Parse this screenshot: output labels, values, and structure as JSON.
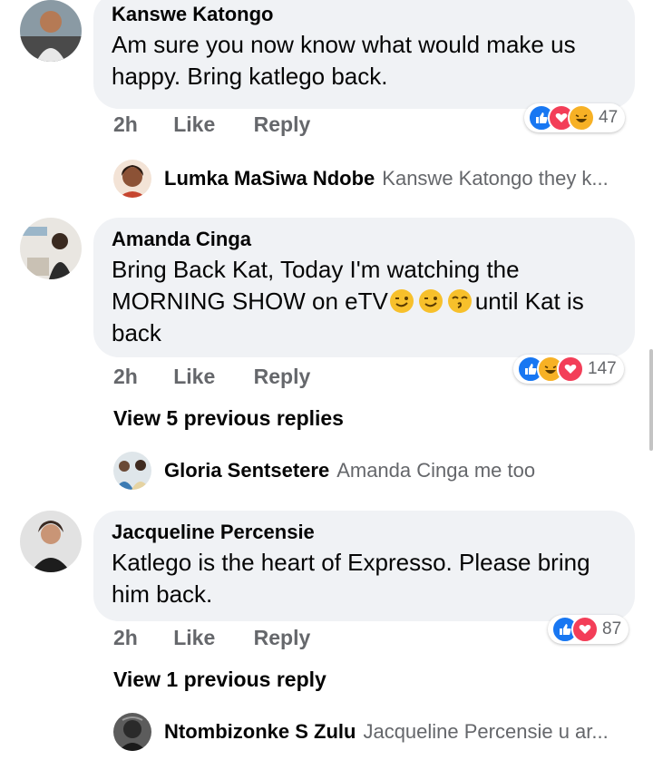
{
  "comments": [
    {
      "author": "Kanswe Katongo",
      "text": "Am sure you now know what would make us happy. Bring katlego back.",
      "time": "2h",
      "like_label": "Like",
      "reply_label": "Reply",
      "reaction_count": "47",
      "reactions": [
        "like",
        "love",
        "haha"
      ],
      "reply_preview": {
        "author": "Lumka MaSiwa Ndobe",
        "text": "Kanswe Katongo they k..."
      }
    },
    {
      "author": "Amanda Cinga",
      "text_before": "Bring Back Kat,  Today I'm watching the MORNING SHOW on eTV",
      "text_after": "until Kat is back",
      "time": "2h",
      "like_label": "Like",
      "reply_label": "Reply",
      "reaction_count": "147",
      "reactions": [
        "like",
        "haha",
        "love"
      ],
      "view_more": "View 5 previous replies",
      "reply_preview": {
        "author": "Gloria Sentsetere",
        "text": "Amanda Cinga me too"
      }
    },
    {
      "author": "Jacqueline Percensie",
      "text": "Katlego is the heart of Expresso. Please bring him back.",
      "time": "2h",
      "like_label": "Like",
      "reply_label": "Reply",
      "reaction_count": "87",
      "reactions": [
        "like",
        "love"
      ],
      "view_more": "View 1 previous reply",
      "reply_preview": {
        "author": "Ntombizonke S Zulu",
        "text": "Jacqueline Percensie u ar..."
      }
    }
  ],
  "colors": {
    "bubble": "#f0f2f5",
    "meta_text": "#65676b",
    "like": "#1877f2",
    "love": "#f33e58",
    "haha": "#f7b125"
  }
}
